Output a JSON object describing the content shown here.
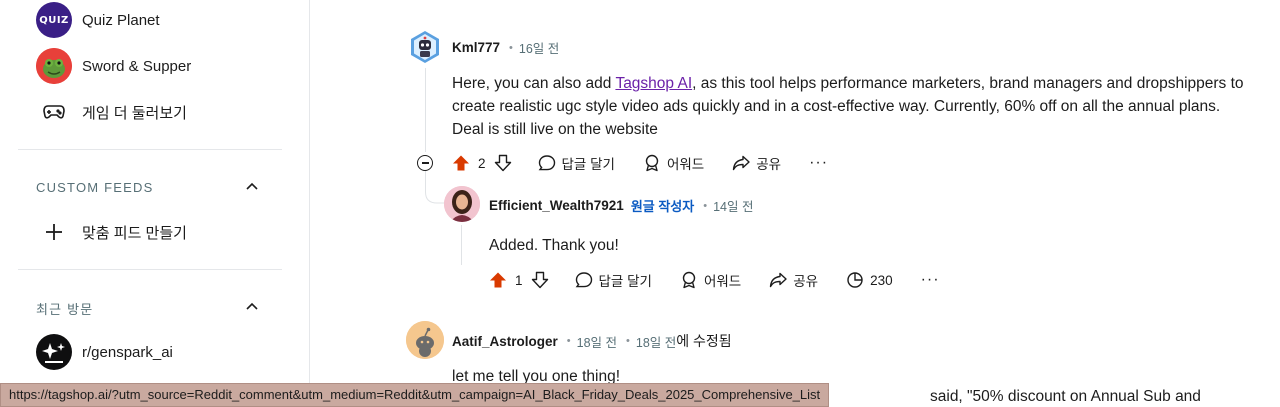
{
  "sidebar": {
    "games": [
      {
        "label": "Quiz Planet",
        "avatar_text": "QUIZ",
        "icon": "quiz-planet-avatar"
      },
      {
        "label": "Sword & Supper",
        "icon": "sword-supper-avatar"
      },
      {
        "label": "게임 더 둘러보기",
        "icon": "gamepad-icon"
      }
    ],
    "custom_feeds": {
      "title": "CUSTOM FEEDS",
      "create_label": "맞춤 피드 만들기"
    },
    "recent": {
      "title": "최근 방문",
      "items": [
        {
          "label": "r/genspark_ai",
          "icon": "genspark-avatar"
        }
      ]
    }
  },
  "comments": [
    {
      "author": "Kml777",
      "time": "16일 전",
      "body_before_link": "Here, you can also add ",
      "link_text": "Tagshop AI",
      "body_after_link": ", as this tool helps performance marketers, brand managers and dropshippers to create realistic ugc style video ads quickly and in a cost-effective way. Currently, 60% off on all the annual plans. Deal is still live on the website",
      "votes": "2",
      "reply_label": "답글 달기",
      "award_label": "어워드",
      "share_label": "공유",
      "more_label": "···"
    },
    {
      "author": "Efficient_Wealth7921",
      "op_badge": "원글 작성자",
      "time": "14일 전",
      "body": "Added. Thank you!",
      "votes": "1",
      "reply_label": "답글 달기",
      "award_label": "어워드",
      "share_label": "공유",
      "views": "230",
      "more_label": "···"
    },
    {
      "author": "Aatif_Astrologer",
      "time": "18일 전",
      "edited_time": "18일 전",
      "edited_label": "에 수정됨",
      "body": "let me tell you one thing!"
    }
  ],
  "obscured_text": "said, \"50% discount on Annual Sub and",
  "status_bar": {
    "url": "https://tagshop.ai/?utm_source=Reddit_comment&utm_medium=Reddit&utm_campaign=AI_Black_Friday_Deals_2025_Comprehensive_List"
  },
  "colors": {
    "upvote_active": "#d93a00",
    "op_badge": "#0a5ac2",
    "link": "#6b21a8",
    "status_bar_bg": "#c9a99f"
  }
}
